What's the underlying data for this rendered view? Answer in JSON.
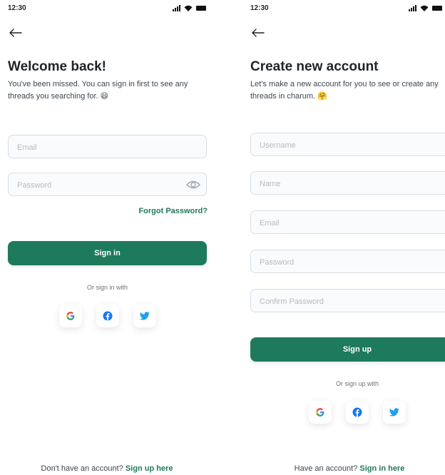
{
  "login": {
    "status_time": "12:30",
    "title": "Welcome back!",
    "subtitle": "You've been missed. You can sign in first to see any threads you searching for. 😄",
    "email_placeholder": "Email",
    "password_placeholder": "Password",
    "forgot_label": "Forgot Password?",
    "submit_label": "Sign in",
    "alt_label": "Or sign in with",
    "footer_text": "Don't have an account?",
    "footer_link": "Sign up here"
  },
  "signup": {
    "status_time": "12:30",
    "title": "Create new account",
    "subtitle": "Let's make a new account for you to see or create any threads in charum. 🤗",
    "username_placeholder": "Username",
    "name_placeholder": "Name",
    "email_placeholder": "Email",
    "password_placeholder": "Password",
    "confirm_placeholder": "Confirm Password",
    "submit_label": "Sign up",
    "alt_label": "Or sign up with",
    "footer_text": "Have an account?",
    "footer_link": "Sign in here"
  },
  "social_icons": [
    "google-icon",
    "facebook-icon",
    "twitter-icon"
  ],
  "colors": {
    "primary": "#1e7a5c",
    "link": "#1f7a5a",
    "text": "#1f2429",
    "field_border": "#d8dee4",
    "facebook": "#1877f2",
    "twitter": "#1da1f2"
  }
}
